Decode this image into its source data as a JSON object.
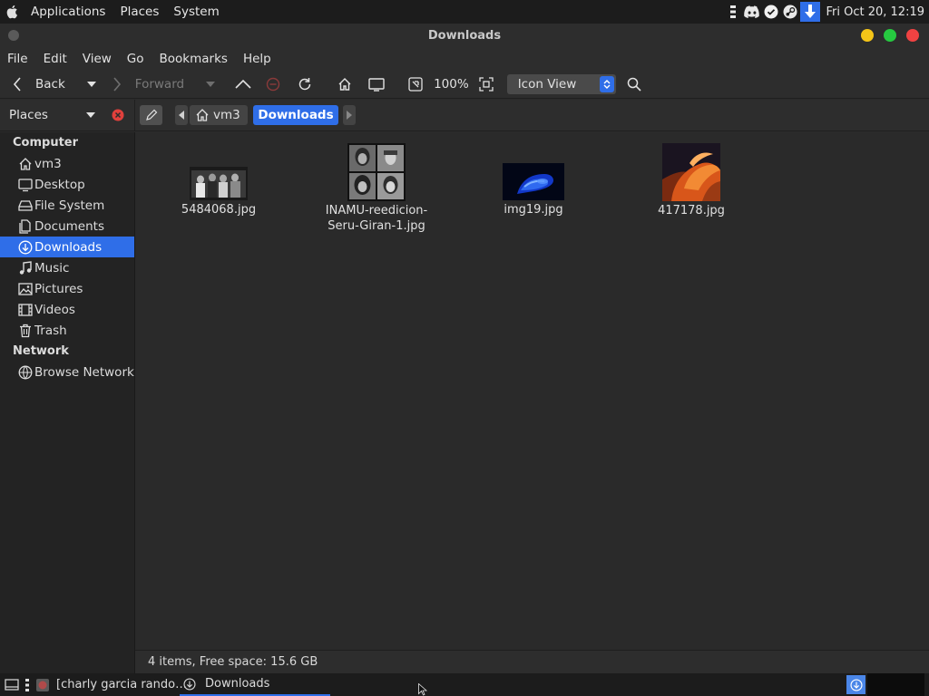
{
  "top_panel": {
    "menus": [
      "Applications",
      "Places",
      "System"
    ],
    "tray_icons": [
      "grid-icon",
      "discord-icon",
      "check-circle-icon",
      "steam-icon",
      "download-arrow-icon"
    ],
    "clock": "Fri Oct 20, 12:19"
  },
  "window": {
    "title": "Downloads",
    "controls": {
      "minimize": "#f5c518",
      "maximize": "#26c940",
      "close": "#f04242"
    }
  },
  "menubar": [
    "File",
    "Edit",
    "View",
    "Go",
    "Bookmarks",
    "Help"
  ],
  "toolbar": {
    "back_label": "Back",
    "forward_label": "Forward",
    "zoom": "100%",
    "view_mode": "Icon View"
  },
  "location": {
    "places_label": "Places",
    "crumbs": [
      "vm3",
      "Downloads"
    ]
  },
  "sidebar": {
    "sections": [
      {
        "title": "Computer",
        "items": [
          {
            "label": "vm3",
            "icon": "home-icon"
          },
          {
            "label": "Desktop",
            "icon": "desktop-icon"
          },
          {
            "label": "File System",
            "icon": "drive-icon"
          },
          {
            "label": "Documents",
            "icon": "documents-icon"
          },
          {
            "label": "Downloads",
            "icon": "download-icon",
            "active": true
          },
          {
            "label": "Music",
            "icon": "music-icon"
          },
          {
            "label": "Pictures",
            "icon": "pictures-icon"
          },
          {
            "label": "Videos",
            "icon": "videos-icon"
          },
          {
            "label": "Trash",
            "icon": "trash-icon"
          }
        ]
      },
      {
        "title": "Network",
        "items": [
          {
            "label": "Browse Network",
            "icon": "network-icon"
          }
        ]
      }
    ]
  },
  "files": [
    {
      "name": "5484068.jpg",
      "line2": ""
    },
    {
      "name": "INAMU-reedicion-",
      "line2": "Seru-Giran-1.jpg"
    },
    {
      "name": "img19.jpg",
      "line2": ""
    },
    {
      "name": "417178.jpg",
      "line2": ""
    }
  ],
  "status": "4 items, Free space: 15.6 GB",
  "taskbar": {
    "tasks": [
      "[charly garcia rando…",
      "Downloads"
    ]
  },
  "accent": "#2f6ee8"
}
